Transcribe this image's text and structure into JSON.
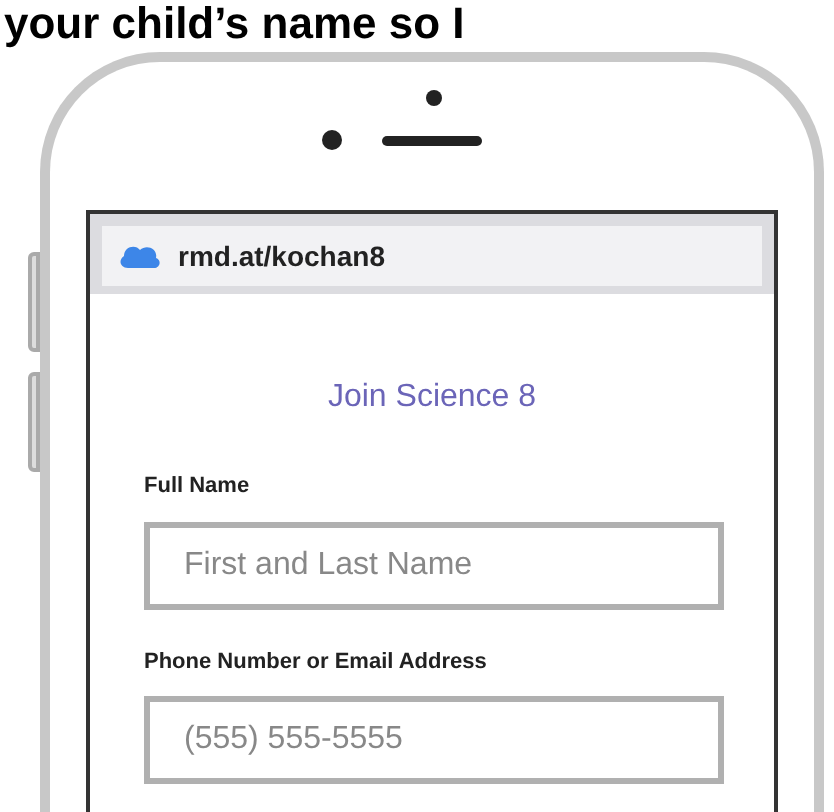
{
  "caption": "your child’s name so I",
  "browser": {
    "url": "rmd.at/kochan8"
  },
  "form": {
    "title": "Join Science 8",
    "fields": [
      {
        "label": "Full Name",
        "placeholder": "First and Last Name"
      },
      {
        "label": "Phone Number or Email Address",
        "placeholder": "(555) 555-5555"
      }
    ]
  }
}
